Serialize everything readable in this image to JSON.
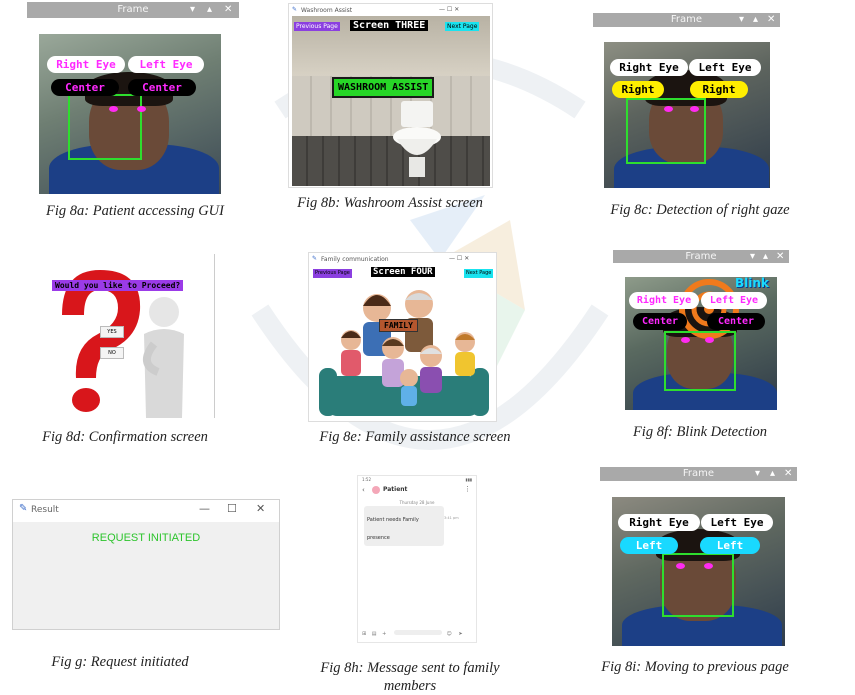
{
  "figures": {
    "f8a": {
      "caption": "Fig 8a: Patient accessing GUI",
      "window_title": "Frame",
      "labels": {
        "right_eye": "Right Eye",
        "left_eye": "Left Eye",
        "right_status": "Center",
        "left_status": "Center"
      }
    },
    "f8b": {
      "caption": "Fig 8b: Washroom Assist screen",
      "window_title": "Washroom Assist",
      "prev_button": "Previous Page",
      "next_button": "Next Page",
      "screen_label": "Screen THREE",
      "banner": "WASHROOM ASSIST"
    },
    "f8c": {
      "caption": "Fig 8c: Detection of right gaze",
      "window_title": "Frame",
      "labels": {
        "right_eye": "Right Eye",
        "left_eye": "Left Eye",
        "right_status": "Right",
        "left_status": "Right"
      }
    },
    "f8d": {
      "caption": "Fig 8d: Confirmation screen",
      "question": "Would you like to Proceed?",
      "yes": "YES",
      "no": "NO"
    },
    "f8e": {
      "caption": "Fig 8e: Family assistance screen",
      "window_title": "Family communication",
      "prev_button": "Previous Page",
      "next_button": "Next Page",
      "screen_label": "Screen FOUR",
      "banner": "FAMILY"
    },
    "f8f": {
      "caption": "Fig 8f: Blink Detection",
      "window_title": "Frame",
      "blink": "Blink",
      "labels": {
        "right_eye": "Right Eye",
        "left_eye": "Left Eye",
        "right_status": "Center",
        "left_status": "Center"
      }
    },
    "fg": {
      "caption": "Fig g: Request initiated",
      "window_title": "Result",
      "message": "REQUEST INITIATED"
    },
    "f8h": {
      "caption_line1": "Fig 8h: Message sent to family",
      "caption_line2": "members",
      "contact": "Patient",
      "day": "Thursday 28 June",
      "message": "Patient needs Family presence",
      "time": "3:41 pm"
    },
    "f8i": {
      "caption": "Fig 8i: Moving to previous page",
      "window_title": "Frame",
      "labels": {
        "right_eye": "Right Eye",
        "left_eye": "Left Eye",
        "right_status": "Left",
        "left_status": "Left"
      }
    }
  },
  "colors": {
    "face_box": "#2ede2e",
    "eye_marker": "#ff2bf1",
    "gui_title_bar": "#a9a9a9",
    "request_text": "#2dc42d"
  },
  "icons": [
    "close-icon",
    "minimize-icon",
    "maximize-icon",
    "feather-icon",
    "question-mark-icon",
    "thinking-figure-icon",
    "toilet-icon",
    "family-icon",
    "whatsapp-icon",
    "target-icon"
  ]
}
